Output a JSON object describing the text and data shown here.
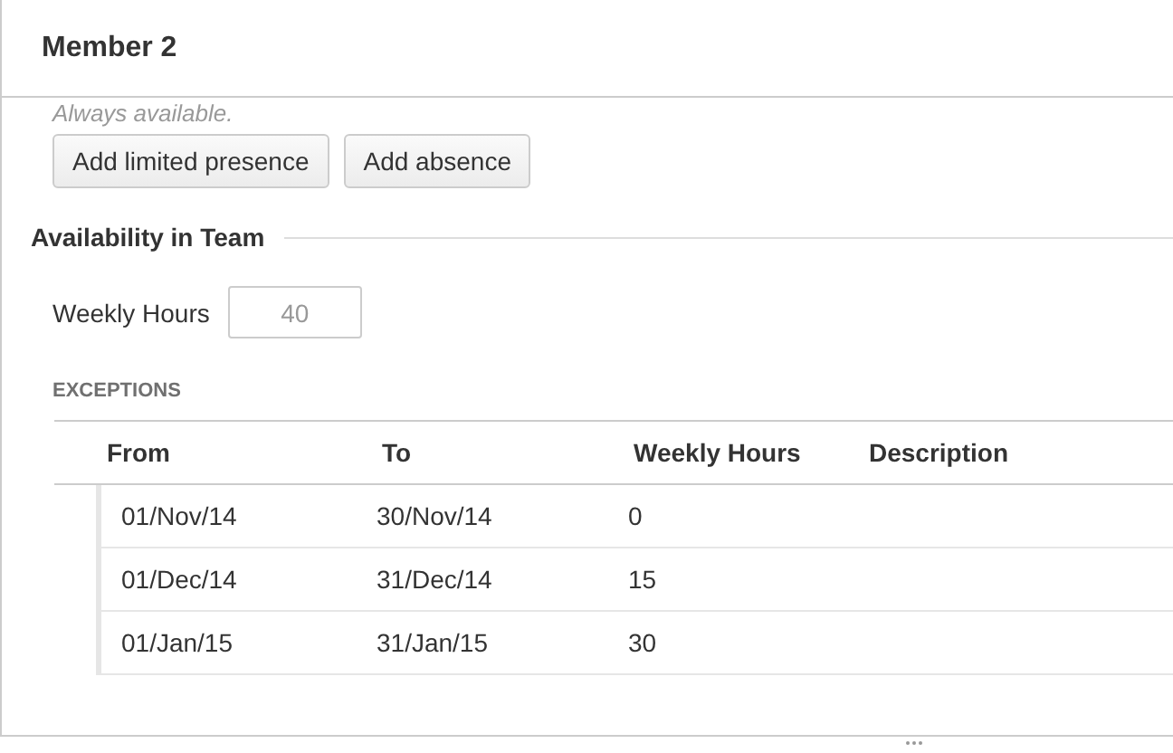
{
  "panel": {
    "title": "Member 2"
  },
  "presence": {
    "note": "Always available.",
    "buttons": [
      "Add limited presence",
      "Add absence"
    ]
  },
  "team_availability": {
    "heading": "Availability in Team",
    "weekly_hours": {
      "label": "Weekly Hours",
      "value": "40"
    }
  },
  "exceptions": {
    "heading": "EXCEPTIONS",
    "columns": [
      "From",
      "To",
      "Weekly Hours",
      "Description"
    ],
    "rows": [
      {
        "from": "01/Nov/14",
        "to": "30/Nov/14",
        "weekly_hours": "0"
      },
      {
        "from": "01/Dec/14",
        "to": "31/Dec/14",
        "weekly_hours": "15"
      },
      {
        "from": "01/Jan/15",
        "to": "31/Jan/15",
        "weekly_hours": "30"
      }
    ]
  }
}
